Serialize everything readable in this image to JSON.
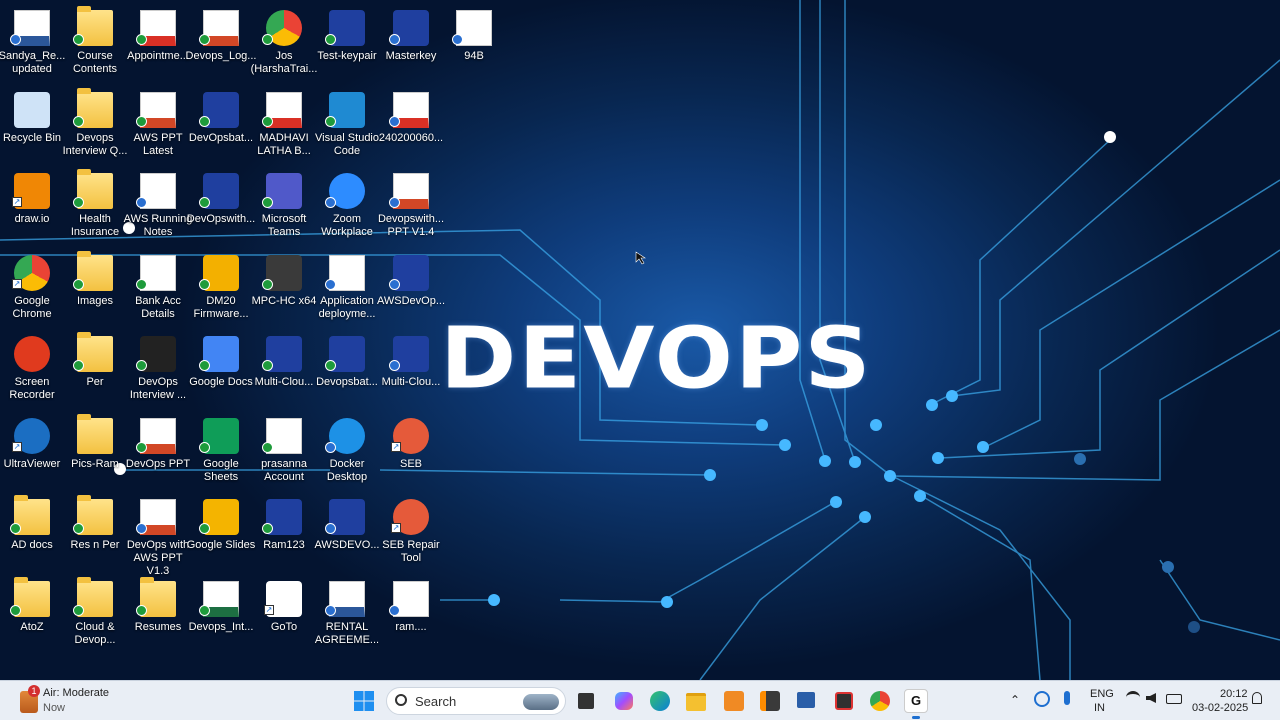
{
  "desktop": {
    "title": "DEVOPS",
    "icons": [
      {
        "label": "Sandya_Re... updated",
        "kind": "word",
        "sync": "cloud"
      },
      {
        "label": "Course Contents",
        "kind": "folder",
        "sync": "green"
      },
      {
        "label": "Appointme...",
        "kind": "pdf",
        "sync": "green"
      },
      {
        "label": "Devops_Log...",
        "kind": "ppt",
        "sync": "green"
      },
      {
        "label": "Jos (HarshaTrai...",
        "kind": "chrome",
        "sync": "green"
      },
      {
        "label": "Test-keypair",
        "kind": "putty",
        "sync": "green"
      },
      {
        "label": "Masterkey",
        "kind": "putty",
        "sync": "cloud"
      },
      {
        "label": "94B",
        "kind": "file",
        "sync": "cloud"
      },
      {
        "label": "Recycle Bin",
        "kind": "recycle",
        "sync": ""
      },
      {
        "label": "Devops Interview Q...",
        "kind": "folder",
        "sync": "green"
      },
      {
        "label": "AWS PPT Latest",
        "kind": "ppt",
        "sync": "green"
      },
      {
        "label": "DevOpsbat...",
        "kind": "putty",
        "sync": "green"
      },
      {
        "label": "MADHAVI LATHA B...",
        "kind": "pdf",
        "sync": "green"
      },
      {
        "label": "Visual Studio Code",
        "kind": "vscode",
        "sync": "green"
      },
      {
        "label": "240200060...",
        "kind": "pdf",
        "sync": "cloud"
      },
      {
        "label": "draw.io",
        "kind": "drawio",
        "sync": "shortcut"
      },
      {
        "label": "Health Insurance",
        "kind": "folder",
        "sync": "green"
      },
      {
        "label": "AWS Running Notes",
        "kind": "file",
        "sync": "cloud"
      },
      {
        "label": "DevOpswith...",
        "kind": "putty",
        "sync": "green"
      },
      {
        "label": "Microsoft Teams",
        "kind": "teams",
        "sync": "green"
      },
      {
        "label": "Zoom Workplace",
        "kind": "zoom",
        "sync": "cloud"
      },
      {
        "label": "Devopswith... PPT V1.4",
        "kind": "ppt",
        "sync": "cloud"
      },
      {
        "label": "Google Chrome",
        "kind": "chrome",
        "sync": "shortcut"
      },
      {
        "label": "Images",
        "kind": "folder",
        "sync": "green"
      },
      {
        "label": "Bank Acc Details",
        "kind": "file",
        "sync": "green"
      },
      {
        "label": "DM20 Firmware...",
        "kind": "dm20",
        "sync": "green"
      },
      {
        "label": "MPC-HC x64",
        "kind": "mpc",
        "sync": "green"
      },
      {
        "label": "Application deployme...",
        "kind": "file",
        "sync": "cloud"
      },
      {
        "label": "AWSDevOp...",
        "kind": "putty",
        "sync": "cloud"
      },
      {
        "label": "Screen Recorder",
        "kind": "recorder",
        "sync": ""
      },
      {
        "label": "Per",
        "kind": "folder",
        "sync": "green"
      },
      {
        "label": "DevOps Interview ...",
        "kind": "video",
        "sync": "green"
      },
      {
        "label": "Google Docs",
        "kind": "gdocs",
        "sync": "green"
      },
      {
        "label": "Multi-Clou...",
        "kind": "putty",
        "sync": "green"
      },
      {
        "label": "Devopsbat...",
        "kind": "putty",
        "sync": "green"
      },
      {
        "label": "Multi-Clou...",
        "kind": "putty",
        "sync": "cloud"
      },
      {
        "label": "UltraViewer",
        "kind": "ultra",
        "sync": "shortcut"
      },
      {
        "label": "Pics-Ram",
        "kind": "folder",
        "sync": ""
      },
      {
        "label": "DevOps PPT",
        "kind": "ppt",
        "sync": "green"
      },
      {
        "label": "Google Sheets",
        "kind": "gsheets",
        "sync": "green"
      },
      {
        "label": "prasanna Account",
        "kind": "file",
        "sync": "green"
      },
      {
        "label": "Docker Desktop",
        "kind": "docker",
        "sync": "cloud"
      },
      {
        "label": "SEB",
        "kind": "seb",
        "sync": "shortcut"
      },
      {
        "label": "AD docs",
        "kind": "folder",
        "sync": "green"
      },
      {
        "label": "Res n Per",
        "kind": "folder",
        "sync": "green"
      },
      {
        "label": "DevOps with AWS PPT V1.3",
        "kind": "ppt",
        "sync": "cloud"
      },
      {
        "label": "Google Slides",
        "kind": "gslides",
        "sync": "green"
      },
      {
        "label": "Ram123",
        "kind": "putty",
        "sync": "green"
      },
      {
        "label": "AWSDEVO...",
        "kind": "putty",
        "sync": "cloud"
      },
      {
        "label": "SEB Repair Tool",
        "kind": "seb",
        "sync": "shortcut"
      },
      {
        "label": "AtoZ",
        "kind": "folder",
        "sync": "green"
      },
      {
        "label": "Cloud & Devop...",
        "kind": "folder",
        "sync": "green"
      },
      {
        "label": "Resumes",
        "kind": "folder",
        "sync": "green"
      },
      {
        "label": "Devops_Int...",
        "kind": "excel",
        "sync": "green"
      },
      {
        "label": "GoTo",
        "kind": "goto",
        "sync": "shortcut"
      },
      {
        "label": "RENTAL AGREEME...",
        "kind": "word",
        "sync": "cloud"
      },
      {
        "label": "ram....",
        "kind": "file",
        "sync": "cloud"
      }
    ]
  },
  "taskbar": {
    "weather_badge": "1",
    "weather_title": "Air: Moderate",
    "weather_sub": "Now",
    "search_placeholder": "Search",
    "lang_top": "ENG",
    "lang_bottom": "IN",
    "time": "20:12",
    "date": "03-02-2025",
    "apps": [
      "windows-start",
      "search",
      "task-view",
      "copilot",
      "edge",
      "file-explorer",
      "orange-app",
      "sublime-text",
      "remote-desktop",
      "snipping-tool",
      "google-chrome",
      "goto"
    ]
  }
}
